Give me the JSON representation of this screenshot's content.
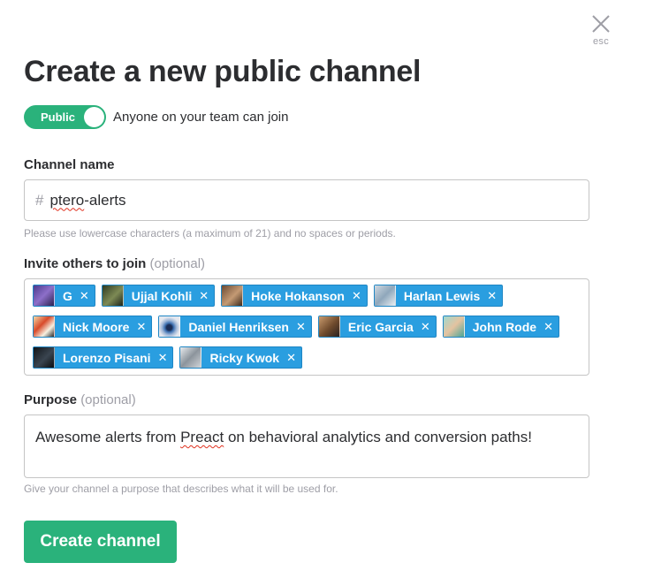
{
  "close": {
    "esc_label": "esc",
    "icon": "close-icon"
  },
  "title": "Create a new public channel",
  "visibility_toggle": {
    "label": "Public",
    "state": "on",
    "description": "Anyone on your team can join",
    "color": "#2ab27b"
  },
  "channel_name": {
    "label": "Channel name",
    "prefix": "#",
    "value_misspelled_part": "ptero",
    "value_rest": "-alerts",
    "hint": "Please use lowercase characters (a maximum of 21) and no spaces or periods."
  },
  "invite": {
    "label": "Invite others to join",
    "optional": "(optional)",
    "chip_color": "#2a9ee0",
    "remove_glyph": "✕",
    "members": [
      {
        "name": "G",
        "avatar": "avatar-purple"
      },
      {
        "name": "Ujjal Kohli",
        "avatar": "avatar-dark-green"
      },
      {
        "name": "Hoke Hokanson",
        "avatar": "avatar-brown"
      },
      {
        "name": "Harlan Lewis",
        "avatar": "avatar-light"
      },
      {
        "name": "Nick Moore",
        "avatar": "avatar-comic"
      },
      {
        "name": "Daniel Henriksen",
        "avatar": "avatar-eye"
      },
      {
        "name": "Eric Garcia",
        "avatar": "avatar-tan"
      },
      {
        "name": "John Rode",
        "avatar": "avatar-teal"
      },
      {
        "name": "Lorenzo Pisani",
        "avatar": "avatar-dark"
      },
      {
        "name": "Ricky Kwok",
        "avatar": "avatar-grey"
      }
    ]
  },
  "purpose": {
    "label": "Purpose",
    "optional": "(optional)",
    "value_before": "Awesome alerts from ",
    "value_misspelled_part": "Preact",
    "value_after": " on behavioral analytics and conversion paths!",
    "hint": "Give your channel a purpose that describes what it will be used for."
  },
  "create_button": {
    "label": "Create channel",
    "color": "#2ab27b"
  }
}
